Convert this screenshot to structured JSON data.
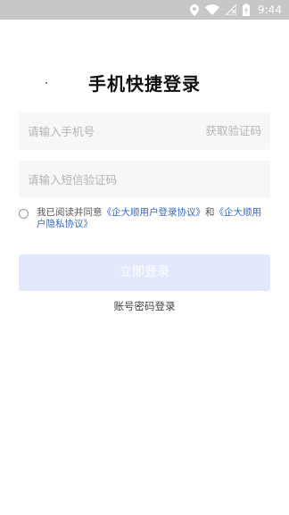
{
  "status_bar": {
    "time": "9:44",
    "icons": [
      "location-icon",
      "wifi-icon",
      "signal-off-icon",
      "battery-charging-icon"
    ]
  },
  "login": {
    "title": "手机快捷登录",
    "phone_placeholder": "请输入手机号",
    "phone_value": "",
    "get_code_label": "获取验证码",
    "code_placeholder": "请输入短信验证码",
    "code_value": "",
    "agreement": {
      "prefix": "我已阅读并同意",
      "link1": "《企大顺用户登录协议》",
      "and": "和",
      "link2": "《企大顺用户隐私协议》",
      "checked": false
    },
    "submit_label": "立即登录",
    "password_login_label": "账号密码登录"
  },
  "colors": {
    "status_bar_bg": "#c7c7c7",
    "button_disabled_bg": "#e3e9fc",
    "link": "#3a68c4",
    "input_bg": "#f7f7f7"
  }
}
